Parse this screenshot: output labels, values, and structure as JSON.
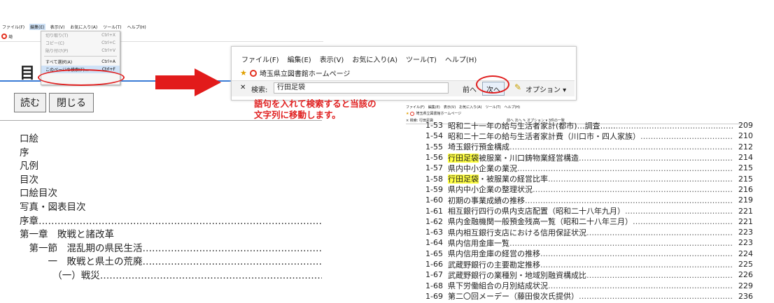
{
  "left": {
    "menubar": {
      "file": "ファイル(F)",
      "edit": "編集(E)",
      "view": "表示(V)",
      "favorites": "お気に入り(A)",
      "tools": "ツール(T)",
      "help": "ヘルプ(H)"
    },
    "favbar_text": "埼",
    "dropdown": [
      {
        "label": "切り取り(T)",
        "shortcut": "Ctrl+X"
      },
      {
        "label": "コピー(C)",
        "shortcut": "Ctrl+C"
      },
      {
        "label": "貼り付け(P)",
        "shortcut": "Ctrl+V"
      },
      {
        "label": "すべて選択(A)",
        "shortcut": "Ctrl+A"
      },
      {
        "label": "このページの検索(F)...",
        "shortcut": "Ctrl+F"
      }
    ],
    "doc_title": "目",
    "buttons": {
      "read": "読む",
      "close": "閉じる"
    },
    "toc": [
      "口絵",
      "序",
      "凡例",
      "目次",
      "口絵目次",
      "写真・図表目次",
      "序章………………………………………………………………………………………",
      "第一章　敗戦と諸改革",
      "　第一節　混乱期の県民生活……………………………………………………",
      "　　　一　敗戦と県土の荒廃…………………………………………………",
      "　　　　（一）戦災………………………………………………………………"
    ]
  },
  "zoom": {
    "menu": [
      "ファイル(F)",
      "編集(E)",
      "表示(V)",
      "お気に入り(A)",
      "ツール(T)",
      "ヘルプ(H)"
    ],
    "favorite": "埼玉県立図書館ホームページ",
    "find_label": "検索:",
    "find_value": "行田足袋",
    "prev": "前へ",
    "next": "次へ",
    "options": "オプション ▾"
  },
  "note": [
    "語句を入れて検索すると当該の",
    "文字列に移動します。"
  ],
  "right": {
    "menu": [
      "ファイル(F)",
      "編集(E)",
      "表示(V)",
      "お気に入り(A)",
      "ツール(T)",
      "ヘルプ(H)"
    ],
    "favorite": "埼玉県立図書館ホームページ",
    "find": "× 検索: 行田足袋　　　　　　　　　　　　　　　　　　　　　前へ 次へ ✎ オプション ▾ 3件の一致",
    "rows": [
      {
        "no": "1-53",
        "title": "昭和二十一年の給与生活者家計(都市)…調査……",
        "page": "209"
      },
      {
        "no": "1-54",
        "title": "昭和二十二年の給与生活者家計費（川口市・四人家族）",
        "page": "210"
      },
      {
        "no": "1-55",
        "title": "埼玉銀行預金構成",
        "page": "212"
      },
      {
        "no": "1-56",
        "hl": "行田足袋",
        "title": "被服業・川口鋳物業経営構造",
        "page": "214"
      },
      {
        "no": "1-57",
        "title": "県内中小企業の業況",
        "page": "215"
      },
      {
        "no": "1-58",
        "hl": "行田足袋",
        "title": "・被服業の経営比率",
        "page": "215"
      },
      {
        "no": "1-59",
        "title": "県内中小企業の整理状況",
        "page": "216"
      },
      {
        "no": "1-60",
        "title": "初期の事業成績の推移",
        "page": "219"
      },
      {
        "no": "1-61",
        "title": "相互銀行四行の県内支店配置（昭和二十八年九月）",
        "page": "221"
      },
      {
        "no": "1-62",
        "title": "県内金融機関一般預金残高一覧（昭和二十八年三月）",
        "page": "221"
      },
      {
        "no": "1-63",
        "title": "県内相互銀行支店における信用保証状況",
        "page": "223"
      },
      {
        "no": "1-64",
        "title": "県内信用金庫一覧",
        "page": "223"
      },
      {
        "no": "1-65",
        "title": "県内信用金庫の経営の推移",
        "page": "224"
      },
      {
        "no": "1-66",
        "title": "武蔵野銀行の主要勘定推移",
        "page": "225"
      },
      {
        "no": "1-67",
        "title": "武蔵野銀行の業種別・地域別融資構成比",
        "page": "226"
      },
      {
        "no": "1-68",
        "title": "県下労働組合の月別結成状況",
        "page": "229"
      },
      {
        "no": "1-69",
        "title": "第二〇回メーデー（藤田俊次氏提供）",
        "page": "236"
      }
    ]
  }
}
